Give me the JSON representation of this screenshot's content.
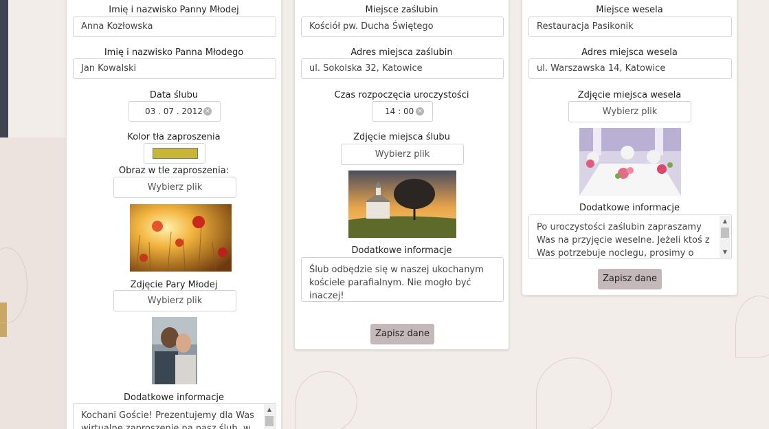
{
  "column1": {
    "bride_label": "Imię i nazwisko Panny Młodej",
    "bride_value": "Anna Kozłowska",
    "groom_label": "Imię i nazwisko Panna Młodego",
    "groom_value": "Jan Kowalski",
    "date_label": "Data ślubu",
    "date_value": "03 . 07 . 2012",
    "color_label": "Kolor tła zaproszenia",
    "color_value": "#c9b43a",
    "bg_image_label": "Obraz w tle zaproszenia:",
    "bg_image_button": "Wybierz plik",
    "couple_photo_label": "Zdjęcie Pary Młodej",
    "couple_photo_button": "Wybierz plik",
    "info_label": "Dodatkowe informacje",
    "info_value": "Kochani Goście! Prezentujemy dla Was wirtualne zaproszenie na nasz ślub, w"
  },
  "column2": {
    "venue_label": "Miejsce zaślubin",
    "venue_value": "Kościół pw. Ducha Świętego",
    "address_label": "Adres miejsca zaślubin",
    "address_value": "ul. Sokolska 32, Katowice",
    "time_label": "Czas rozpoczęcia uroczystości",
    "time_value": "14 : 00",
    "photo_label": "Zdjęcie miejsca ślubu",
    "photo_button": "Wybierz plik",
    "info_label": "Dodatkowe informacje",
    "info_value": "Ślub odbędzie się w naszej ukochanym kościele parafialnym. Nie mogło być inaczej!",
    "save_button": "Zapisz dane"
  },
  "column3": {
    "venue_label": "Miejsce wesela",
    "venue_value": "Restauracja Pasikonik",
    "address_label": "Adres miejsca wesela",
    "address_value": "ul. Warszawska 14, Katowice",
    "photo_label": "Zdjęcie miejsca wesela",
    "photo_button": "Wybierz plik",
    "info_label": "Dodatkowe informacje",
    "info_value": "Po uroczystości zaślubin zapraszamy Was na przyjęcie weselne. Jeżeli ktoś z Was potrzebuje noclegu, prosimy o informację.",
    "save_button": "Zapisz dane"
  },
  "icons": {
    "clear": "×",
    "scroll_up": "▲",
    "scroll_down": "▼"
  }
}
